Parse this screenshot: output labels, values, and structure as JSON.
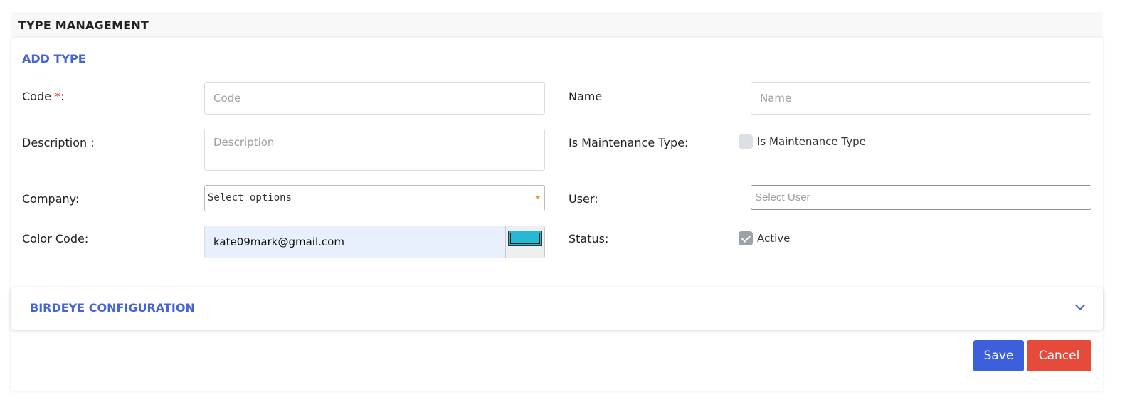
{
  "page": {
    "title": "TYPE MANAGEMENT"
  },
  "form": {
    "section_title": "ADD TYPE",
    "code": {
      "label": "Code",
      "required_mark": "*",
      "suffix": ":",
      "placeholder": "Code"
    },
    "name": {
      "label": "Name",
      "placeholder": "Name"
    },
    "description": {
      "label": "Description :",
      "placeholder": "Description"
    },
    "is_maintenance": {
      "label": "Is Maintenance Type:",
      "checkbox_label": "Is Maintenance Type",
      "checked": false
    },
    "company": {
      "label": "Company:",
      "value": "Select options"
    },
    "user": {
      "label": "User:",
      "placeholder": "Select User"
    },
    "color_code": {
      "label": "Color Code:",
      "value": "kate09mark@gmail.com",
      "swatch_color": "#26b9d4"
    },
    "status": {
      "label": "Status:",
      "checkbox_label": "Active",
      "checked": true
    }
  },
  "birdeye": {
    "title": "BIRDEYE CONFIGURATION",
    "icon": "chevron-down-icon"
  },
  "actions": {
    "save_label": "Save",
    "cancel_label": "Cancel"
  },
  "colors": {
    "accent": "#4564d6",
    "save": "#3d5fdc",
    "cancel": "#e64a3b",
    "required": "#e03b2f"
  }
}
